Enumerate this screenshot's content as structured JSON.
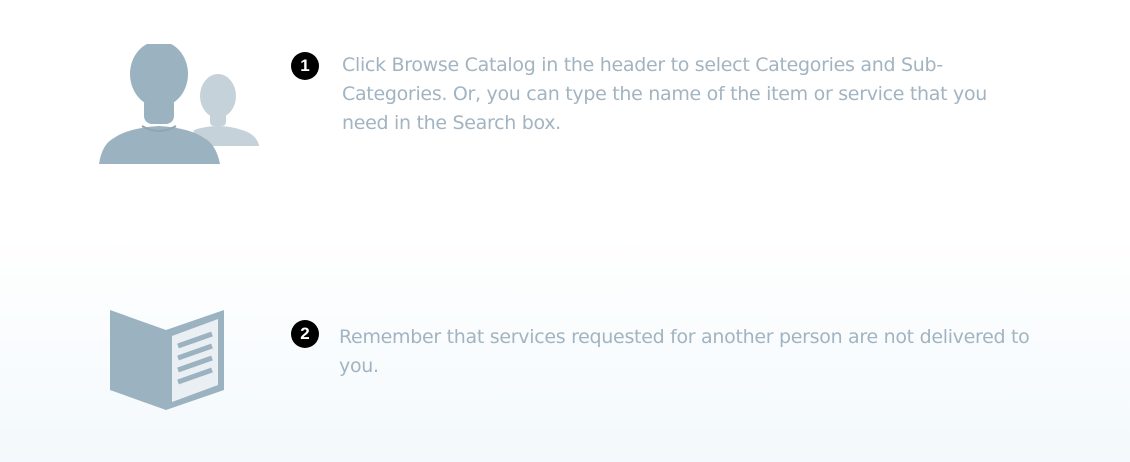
{
  "steps": [
    {
      "number": "1",
      "icon": "users-icon",
      "text": "Click Browse Catalog in the header to select Categories and Sub-Categories. Or, you can type the name of the item or service that you need in the Search box."
    },
    {
      "number": "2",
      "icon": "open-book-icon",
      "text": "Remember that services requested for another person are not delivered to you."
    }
  ],
  "colors": {
    "icon_primary": "#9bb2c1",
    "icon_secondary": "#c6d2da",
    "text": "#a2b4c1",
    "badge": "#000000"
  }
}
